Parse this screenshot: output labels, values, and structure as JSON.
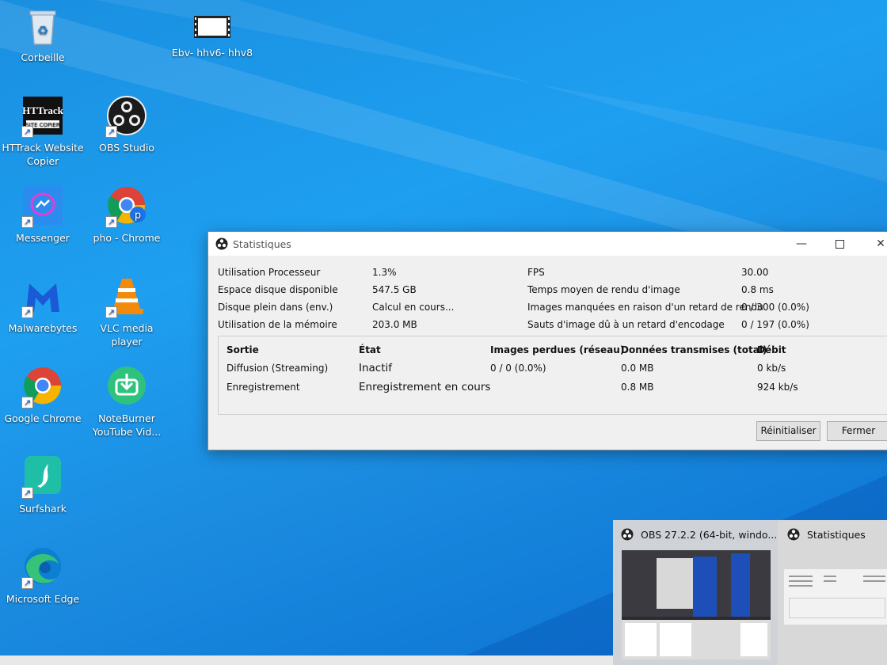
{
  "desktop": {
    "icons": [
      {
        "label": "Corbeille",
        "icon": "recycle-bin-icon"
      },
      {
        "label": "Ebv-  hhv6-  hhv8",
        "icon": "video-file-icon"
      },
      {
        "label": "HTTrack Website Copier",
        "icon": "httrack-icon",
        "logo_text": "HTTrack"
      },
      {
        "label": "OBS Studio",
        "icon": "obs-icon"
      },
      {
        "label": "Messenger",
        "icon": "messenger-icon"
      },
      {
        "label": "pho - Chrome",
        "icon": "chrome-profile-icon",
        "badge": "p"
      },
      {
        "label": "Malwarebytes",
        "icon": "malwarebytes-icon"
      },
      {
        "label": "VLC media player",
        "icon": "vlc-icon"
      },
      {
        "label": "Google Chrome",
        "icon": "chrome-icon"
      },
      {
        "label": "NoteBurner YouTube Vid...",
        "icon": "noteburner-icon"
      },
      {
        "label": "Surfshark",
        "icon": "surfshark-icon"
      },
      {
        "label": "Microsoft Edge",
        "icon": "edge-icon"
      }
    ]
  },
  "stats_window": {
    "title": "Statistiques",
    "left": [
      {
        "label": "Utilisation Processeur",
        "value": "1.3%"
      },
      {
        "label": "Espace disque disponible",
        "value": "547.5 GB"
      },
      {
        "label": "Disque plein dans (env.)",
        "value": "Calcul en cours..."
      },
      {
        "label": "Utilisation de la mémoire",
        "value": "203.0 MB"
      }
    ],
    "right": [
      {
        "label": "FPS",
        "value": "30.00"
      },
      {
        "label": "Temps moyen de rendu d'image",
        "value": "0.8 ms"
      },
      {
        "label": "Images manquées en raison d'un retard de rendu",
        "value": "0 / 300 (0.0%)"
      },
      {
        "label": "Sauts d'image dû à un retard d'encodage",
        "value": "0 / 197 (0.0%)"
      }
    ],
    "outputs": {
      "headers": [
        "Sortie",
        "État",
        "Images perdues (réseau)",
        "Données transmises (total)",
        "Débit"
      ],
      "rows": [
        [
          "Diffusion (Streaming)",
          "Inactif",
          "0 / 0 (0.0%)",
          "0.0 MB",
          "0 kb/s"
        ],
        [
          "Enregistrement",
          "Enregistrement en cours",
          "",
          "0.8 MB",
          "924 kb/s"
        ]
      ]
    },
    "buttons": {
      "reset": "Réinitialiser",
      "close": "Fermer"
    }
  },
  "taskbar_preview": {
    "tiles": [
      {
        "title": "OBS 27.2.2 (64-bit, windo..."
      },
      {
        "title": "Statistiques"
      }
    ]
  },
  "colors": {
    "desktop": "#1e9ff0",
    "window_bg": "#f0f0f0",
    "accent": "#1560c9"
  }
}
